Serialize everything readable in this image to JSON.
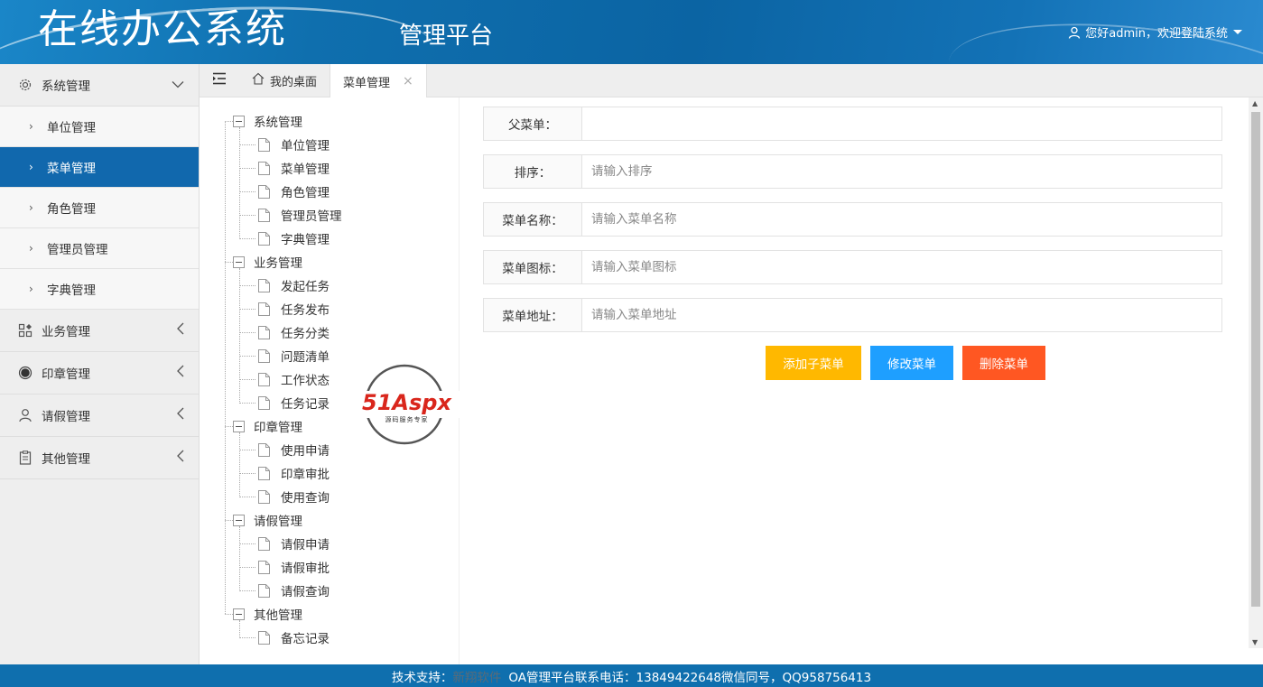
{
  "header": {
    "title": "在线办公系统",
    "subtitle": "管理平台",
    "user_greeting": "您好admin，欢迎登陆系统"
  },
  "sidebar": {
    "groups": [
      {
        "label": "系统管理",
        "icon": "gear-icon",
        "expanded": true,
        "items": [
          {
            "label": "单位管理",
            "active": false
          },
          {
            "label": "菜单管理",
            "active": true
          },
          {
            "label": "角色管理",
            "active": false
          },
          {
            "label": "管理员管理",
            "active": false
          },
          {
            "label": "字典管理",
            "active": false
          }
        ]
      },
      {
        "label": "业务管理",
        "icon": "apps-icon",
        "expanded": false
      },
      {
        "label": "印章管理",
        "icon": "seal-icon",
        "expanded": false
      },
      {
        "label": "请假管理",
        "icon": "user-icon",
        "expanded": false
      },
      {
        "label": "其他管理",
        "icon": "clipboard-icon",
        "expanded": false
      }
    ]
  },
  "tabs": [
    {
      "label": "我的桌面",
      "icon": "home-icon",
      "active": false
    },
    {
      "label": "菜单管理",
      "active": true,
      "closable": true
    }
  ],
  "tree": [
    {
      "label": "系统管理",
      "children": [
        "单位管理",
        "菜单管理",
        "角色管理",
        "管理员管理",
        "字典管理"
      ]
    },
    {
      "label": "业务管理",
      "children": [
        "发起任务",
        "任务发布",
        "任务分类",
        "问题清单",
        "工作状态",
        "任务记录"
      ]
    },
    {
      "label": "印章管理",
      "children": [
        "使用申请",
        "印章审批",
        "使用查询"
      ]
    },
    {
      "label": "请假管理",
      "children": [
        "请假申请",
        "请假审批",
        "请假查询"
      ]
    },
    {
      "label": "其他管理",
      "children": [
        "备忘记录"
      ]
    }
  ],
  "form": {
    "parent": {
      "label": "父菜单：",
      "value": "",
      "placeholder": ""
    },
    "sort": {
      "label": "排序：",
      "value": "",
      "placeholder": "请输入排序"
    },
    "name": {
      "label": "菜单名称：",
      "value": "",
      "placeholder": "请输入菜单名称"
    },
    "icon": {
      "label": "菜单图标：",
      "value": "",
      "placeholder": "请输入菜单图标"
    },
    "url": {
      "label": "菜单地址：",
      "value": "",
      "placeholder": "请输入菜单地址"
    }
  },
  "buttons": {
    "add_child": "添加子菜单",
    "edit": "修改菜单",
    "delete": "删除菜单"
  },
  "watermark": {
    "brand": "51Aspx",
    "tagline": "源码服务专家"
  },
  "footer": {
    "prefix": "技术支持：",
    "company": "新翔软件",
    "contact": "OA管理平台联系电话：13849422648微信同号，QQ958756413"
  },
  "colors": {
    "primary": "#1168ad",
    "warn": "#ffb800",
    "normal": "#1e9fff",
    "danger": "#ff5722"
  }
}
